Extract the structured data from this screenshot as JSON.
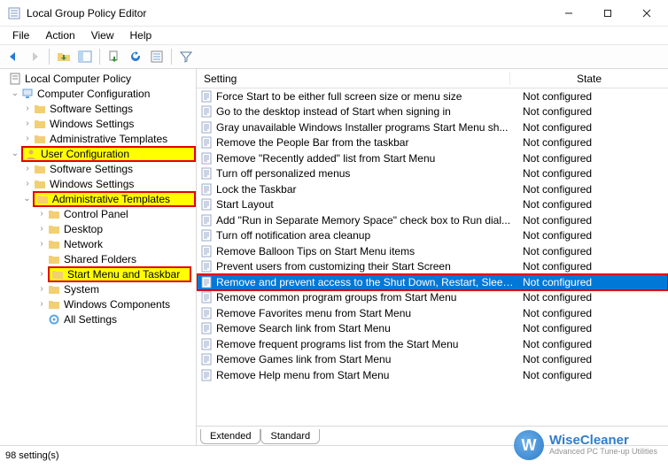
{
  "window": {
    "title": "Local Group Policy Editor"
  },
  "menu": {
    "file": "File",
    "action": "Action",
    "view": "View",
    "help": "Help"
  },
  "tree": {
    "root": "Local Computer Policy",
    "computer_cfg": "Computer Configuration",
    "cc_software": "Software Settings",
    "cc_windows": "Windows Settings",
    "cc_admin": "Administrative Templates",
    "user_cfg": "User Configuration",
    "uc_software": "Software Settings",
    "uc_windows": "Windows Settings",
    "uc_admin": "Administrative Templates",
    "control_panel": "Control Panel",
    "desktop": "Desktop",
    "network": "Network",
    "shared_folders": "Shared Folders",
    "start_menu_taskbar": "Start Menu and Taskbar",
    "system": "System",
    "windows_components": "Windows Components",
    "all_settings": "All Settings"
  },
  "columns": {
    "setting": "Setting",
    "state": "State"
  },
  "state_nc": "Not configured",
  "settings": [
    "Force Start to be either full screen size or menu size",
    "Go to the desktop instead of Start when signing in",
    "Gray unavailable Windows Installer programs Start Menu sh...",
    "Remove the People Bar from the taskbar",
    "Remove \"Recently added\" list from Start Menu",
    "Turn off personalized menus",
    "Lock the Taskbar",
    "Start Layout",
    "Add \"Run in Separate Memory Space\" check box to Run dial...",
    "Turn off notification area cleanup",
    "Remove Balloon Tips on Start Menu items",
    "Prevent users from customizing their Start Screen",
    "Remove and prevent access to the Shut Down, Restart, Sleep...",
    "Remove common program groups from Start Menu",
    "Remove Favorites menu from Start Menu",
    "Remove Search link from Start Menu",
    "Remove frequent programs list from the Start Menu",
    "Remove Games link from Start Menu",
    "Remove Help menu from Start Menu"
  ],
  "selected_index": 12,
  "tabs": {
    "extended": "Extended",
    "standard": "Standard"
  },
  "status": "98 setting(s)",
  "watermark": {
    "brand": "WiseCleaner",
    "tagline": "Advanced PC Tune-up Utilities"
  }
}
